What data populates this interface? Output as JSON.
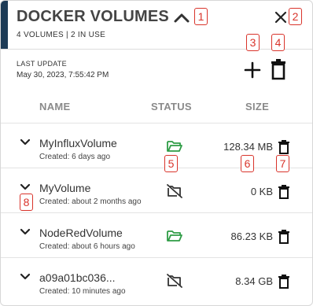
{
  "header": {
    "title": "DOCKER VOLUMES",
    "subtitle": "4 VOLUMES | 2 IN USE"
  },
  "meta": {
    "last_update_label": "LAST UPDATE",
    "last_update_value": "May 30, 2023, 7:55:42 PM"
  },
  "columns": {
    "name": "NAME",
    "status": "STATUS",
    "size": "SIZE"
  },
  "badges": [
    "1",
    "2",
    "3",
    "4",
    "5",
    "6",
    "7",
    "8"
  ],
  "icons": {
    "collapse": "chevron-up-icon",
    "close": "close-icon",
    "add": "plus-icon",
    "delete_all": "trash-icon",
    "row_expand": "chevron-down-icon",
    "status_in_use": "folder-open-icon",
    "status_unused": "folder-off-icon",
    "row_delete": "trash-icon"
  },
  "colors": {
    "accent": "#1d3b56",
    "in_use": "#2e9c45",
    "unused": "#333333",
    "badge": "#d9342b"
  },
  "volumes": [
    {
      "name": "MyInfluxVolume",
      "created": "Created: 6 days ago",
      "status": "in-use",
      "size": "128.34 MB"
    },
    {
      "name": "MyVolume",
      "created": "Created: about 2 months ago",
      "status": "unused",
      "size": "0 KB"
    },
    {
      "name": "NodeRedVolume",
      "created": "Created: about 6 hours ago",
      "status": "in-use",
      "size": "86.23 KB"
    },
    {
      "name": "a09a01bc036...",
      "created": "Created: 10 minutes ago",
      "status": "unused",
      "size": "8.34 GB"
    }
  ]
}
